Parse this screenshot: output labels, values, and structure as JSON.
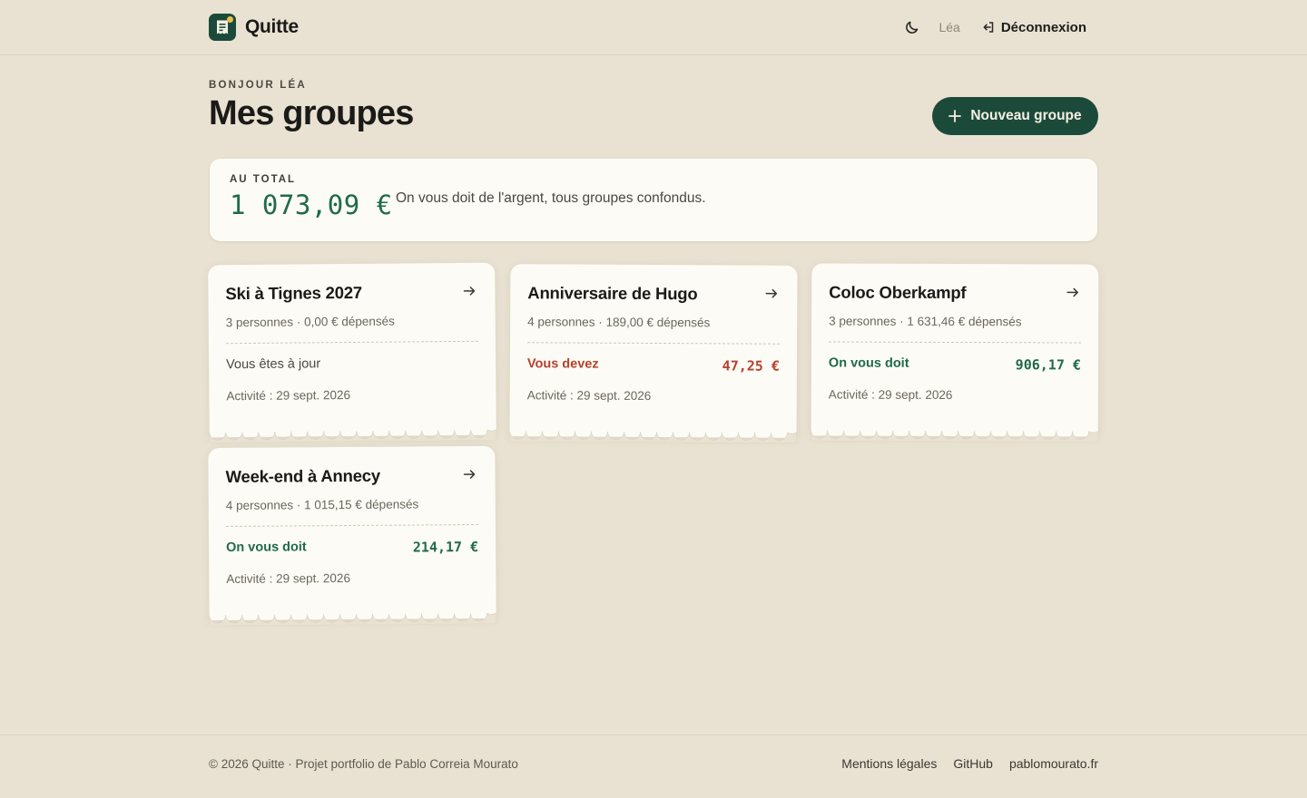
{
  "app": {
    "name": "Quitte"
  },
  "header": {
    "user_name": "Léa",
    "logout_label": "Déconnexion"
  },
  "page": {
    "greeting": "BONJOUR LÉA",
    "title": "Mes groupes",
    "new_group_label": "Nouveau groupe"
  },
  "total": {
    "label": "AU TOTAL",
    "amount": "1 073,09 €",
    "description": "On vous doit de l'argent, tous groupes confondus."
  },
  "groups": [
    {
      "title": "Ski à Tignes 2027",
      "meta": "3 personnes · 0,00 € dépensés",
      "status": "Vous êtes à jour",
      "amount": "",
      "activity": "Activité : 29 sept. 2026"
    },
    {
      "title": "Anniversaire de Hugo",
      "meta": "4 personnes · 189,00 € dépensés",
      "status": "Vous devez",
      "amount": "47,25 €",
      "activity": "Activité : 29 sept. 2026"
    },
    {
      "title": "Coloc Oberkampf",
      "meta": "3 personnes · 1 631,46 € dépensés",
      "status": "On vous doit",
      "amount": "906,17 €",
      "activity": "Activité : 29 sept. 2026"
    },
    {
      "title": "Week-end à Annecy",
      "meta": "4 personnes · 1 015,15 € dépensés",
      "status": "On vous doit",
      "amount": "214,17 €",
      "activity": "Activité : 29 sept. 2026"
    }
  ],
  "footer": {
    "copyright": "© 2026 Quitte · Projet portfolio de Pablo Correia Mourato",
    "links": [
      "Mentions légales",
      "GitHub",
      "pablomourato.fr"
    ]
  },
  "colors": {
    "background": "#e9e2d2",
    "brand_green": "#1c4a3a",
    "positive": "#1f6a4a",
    "negative": "#b5412d",
    "card": "#fdfbf5"
  },
  "icons": [
    "receipt-logo-icon",
    "moon-icon",
    "logout-icon",
    "plus-icon",
    "arrow-right-icon"
  ]
}
